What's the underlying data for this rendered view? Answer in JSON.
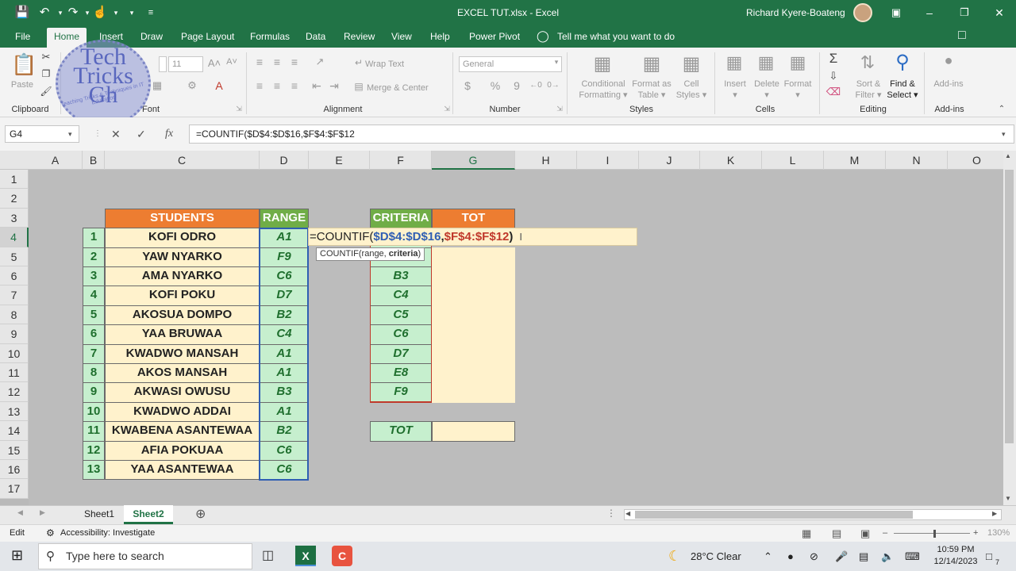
{
  "title_bar": {
    "file_title": "EXCEL TUT.xlsx  -  Excel",
    "user_name": "Richard Kyere-Boateng",
    "save_icon": "save-icon",
    "undo_icon": "undo-icon",
    "redo_icon": "redo-icon",
    "touch_icon": "touch-mode-icon"
  },
  "tabs": [
    "File",
    "Home",
    "Insert",
    "Draw",
    "Page Layout",
    "Formulas",
    "Data",
    "Review",
    "View",
    "Help",
    "Power Pivot"
  ],
  "active_tab": "Home",
  "tell_me": "Tell me what you want to do",
  "logo": {
    "line1": "Tech",
    "line2": "Tricks",
    "line3": "Gh",
    "sub": "Teaching Tricks & Techniques in IT Education"
  },
  "ribbon": {
    "clipboard": {
      "label": "Clipboard",
      "paste": "Paste"
    },
    "font": {
      "label": "Font",
      "size": "11"
    },
    "alignment": {
      "label": "Alignment",
      "wrap_text": "Wrap Text",
      "merge_center": "Merge & Center"
    },
    "number": {
      "label": "Number",
      "format": "General",
      "currency": "$",
      "percent": "%",
      "comma": "9"
    },
    "styles": {
      "label": "Styles",
      "conditional_1": "Conditional",
      "conditional_2": "Formatting",
      "format_table_1": "Format as",
      "format_table_2": "Table",
      "cell_styles_1": "Cell",
      "cell_styles_2": "Styles"
    },
    "cells": {
      "label": "Cells",
      "insert": "Insert",
      "delete": "Delete",
      "format": "Format"
    },
    "editing": {
      "label": "Editing",
      "sort_1": "Sort &",
      "sort_2": "Filter",
      "find_1": "Find &",
      "find_2": "Select"
    },
    "addins": {
      "label": "Add-ins",
      "addins": "Add-ins"
    }
  },
  "formula_bar": {
    "name_box": "G4",
    "formula": "=COUNTIF($D$4:$D$16,$F$4:$F$12"
  },
  "columns": [
    "A",
    "B",
    "C",
    "D",
    "E",
    "F",
    "G",
    "H",
    "I",
    "J",
    "K",
    "L",
    "M",
    "N",
    "O"
  ],
  "selected_column": "G",
  "rows": [
    "1",
    "2",
    "3",
    "4",
    "5",
    "6",
    "7",
    "8",
    "9",
    "10",
    "11",
    "12",
    "13",
    "14",
    "15",
    "16",
    "17"
  ],
  "selected_row": "4",
  "table": {
    "students_header": "STUDENTS",
    "range_header": "RANGE",
    "numbers": [
      "1",
      "2",
      "3",
      "4",
      "5",
      "6",
      "7",
      "8",
      "9",
      "10",
      "11",
      "12",
      "13"
    ],
    "students": [
      "KOFI ODRO",
      "YAW NYARKO",
      "AMA NYARKO",
      "KOFI POKU",
      "AKOSUA DOMPO",
      "YAA BRUWAA",
      "KWADWO MANSAH",
      "AKOS MANSAH",
      "AKWASI OWUSU",
      "KWADWO ADDAI",
      "KWABENA ASANTEWAA",
      "AFIA POKUAA",
      "YAA ASANTEWAA"
    ],
    "ranges": [
      "A1",
      "F9",
      "C6",
      "D7",
      "B2",
      "C4",
      "A1",
      "A1",
      "B3",
      "A1",
      "B2",
      "C6",
      "C6"
    ]
  },
  "criteria": {
    "criteria_header": "CRITERIA",
    "tot_header": "TOT",
    "values": [
      "",
      "",
      "B3",
      "C4",
      "C5",
      "C6",
      "D7",
      "E8",
      "F9"
    ],
    "tot_label": "TOT"
  },
  "edit_cell": {
    "prefix": "=COUNTIF(",
    "arg1": "$D$4:$D$16",
    "comma": ",",
    "arg2": "$F$4:$F$12",
    "suffix": ")",
    "tooltip_fn": "COUNTIF(range, ",
    "tooltip_bold": "criteria",
    "tooltip_end": ")"
  },
  "sheets": [
    "Sheet1",
    "Sheet2"
  ],
  "active_sheet": "Sheet2",
  "status": {
    "mode": "Edit",
    "accessibility": "Accessibility: Investigate",
    "zoom": "130%"
  },
  "taskbar": {
    "search_placeholder": "Type here to search",
    "weather": "28°C  Clear",
    "time": "10:59 PM",
    "date": "12/14/2023",
    "notifications": "7"
  },
  "colors": {
    "excel_green": "#217346",
    "header_orange": "#ed7d31",
    "header_green": "#70ad47",
    "cell_green": "#c6efce",
    "cell_yellow": "#fff2cc",
    "ref_blue": "#2f5eb3",
    "ref_red": "#c0392b"
  }
}
